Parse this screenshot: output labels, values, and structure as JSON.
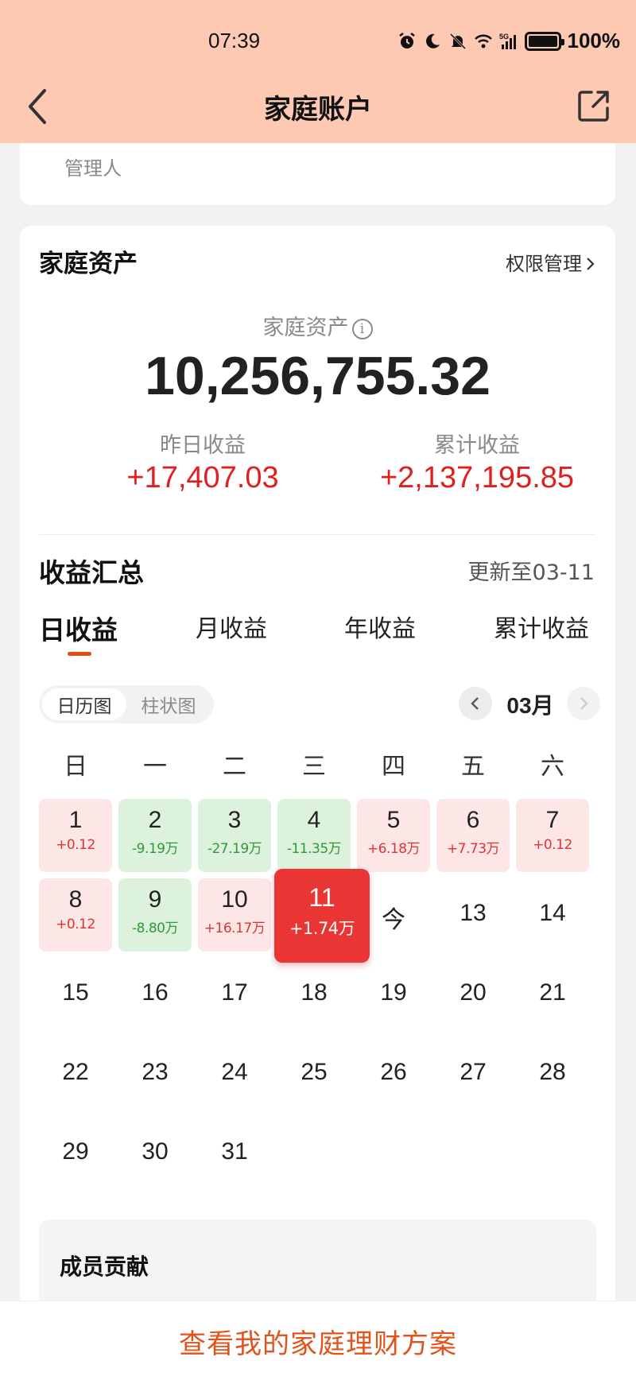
{
  "status_bar": {
    "time": "07:39",
    "battery": "100%",
    "network": "5G"
  },
  "nav": {
    "title": "家庭账户",
    "back_icon": "chevron-left-icon",
    "share_icon": "share-icon"
  },
  "top_card": {
    "role_label": "管理人"
  },
  "assets": {
    "section_title": "家庭资产",
    "permission_link": "权限管理",
    "label": "家庭资产",
    "value": "10,256,755.32",
    "yesterday_label": "昨日收益",
    "yesterday_value": "+17,407.03",
    "cumulative_label": "累计收益",
    "cumulative_value": "+2,137,195.85"
  },
  "summary": {
    "title": "收益汇总",
    "updated": "更新至03-11",
    "tabs": [
      "日收益",
      "月收益",
      "年收益",
      "累计收益"
    ],
    "active_tab": 0,
    "view_toggle": [
      "日历图",
      "柱状图"
    ],
    "active_view": 0,
    "month": "03月"
  },
  "calendar": {
    "weekdays": [
      "日",
      "一",
      "二",
      "三",
      "四",
      "五",
      "六"
    ],
    "days": [
      {
        "label": "1",
        "amount": "+0.12",
        "kind": "pos"
      },
      {
        "label": "2",
        "amount": "-9.19万",
        "kind": "neg"
      },
      {
        "label": "3",
        "amount": "-27.19万",
        "kind": "neg"
      },
      {
        "label": "4",
        "amount": "-11.35万",
        "kind": "neg"
      },
      {
        "label": "5",
        "amount": "+6.18万",
        "kind": "pos"
      },
      {
        "label": "6",
        "amount": "+7.73万",
        "kind": "pos"
      },
      {
        "label": "7",
        "amount": "+0.12",
        "kind": "pos"
      },
      {
        "label": "8",
        "amount": "+0.12",
        "kind": "pos"
      },
      {
        "label": "9",
        "amount": "-8.80万",
        "kind": "neg"
      },
      {
        "label": "10",
        "amount": "+16.17万",
        "kind": "pos"
      },
      {
        "label": "11",
        "amount": "+1.74万",
        "kind": "sel"
      },
      {
        "label": "今",
        "amount": "",
        "kind": "plain"
      },
      {
        "label": "13",
        "amount": "",
        "kind": "plain"
      },
      {
        "label": "14",
        "amount": "",
        "kind": "plain"
      },
      {
        "label": "15",
        "amount": "",
        "kind": "plain"
      },
      {
        "label": "16",
        "amount": "",
        "kind": "plain"
      },
      {
        "label": "17",
        "amount": "",
        "kind": "plain"
      },
      {
        "label": "18",
        "amount": "",
        "kind": "plain"
      },
      {
        "label": "19",
        "amount": "",
        "kind": "plain"
      },
      {
        "label": "20",
        "amount": "",
        "kind": "plain"
      },
      {
        "label": "21",
        "amount": "",
        "kind": "plain"
      },
      {
        "label": "22",
        "amount": "",
        "kind": "plain"
      },
      {
        "label": "23",
        "amount": "",
        "kind": "plain"
      },
      {
        "label": "24",
        "amount": "",
        "kind": "plain"
      },
      {
        "label": "25",
        "amount": "",
        "kind": "plain"
      },
      {
        "label": "26",
        "amount": "",
        "kind": "plain"
      },
      {
        "label": "27",
        "amount": "",
        "kind": "plain"
      },
      {
        "label": "28",
        "amount": "",
        "kind": "plain"
      },
      {
        "label": "29",
        "amount": "",
        "kind": "plain"
      },
      {
        "label": "30",
        "amount": "",
        "kind": "plain"
      },
      {
        "label": "31",
        "amount": "",
        "kind": "plain"
      }
    ]
  },
  "members": {
    "title": "成员贡献"
  },
  "bottom": {
    "button": "查看我的家庭理财方案"
  },
  "colors": {
    "header_bg": "#fdc9b3",
    "positive": "#e02020",
    "negative": "#2e9a3a",
    "accent": "#e0531c"
  }
}
